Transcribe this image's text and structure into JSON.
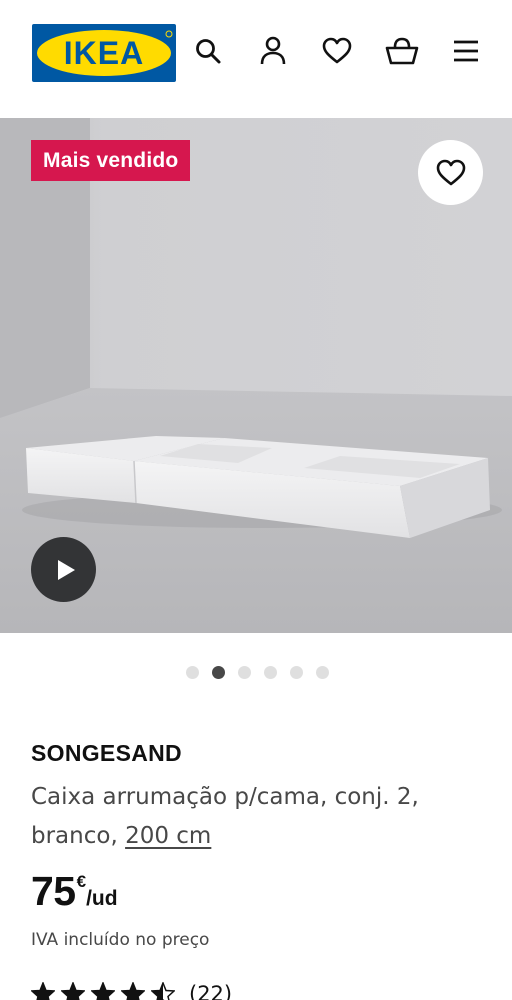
{
  "header": {
    "logo_text": "IKEA",
    "icons": [
      "search-icon",
      "user-icon",
      "heart-icon",
      "basket-icon",
      "menu-icon"
    ]
  },
  "hero": {
    "badge": "Mais vendido",
    "favourite_icon": "heart-icon",
    "play_icon": "play-icon",
    "image_count": 6,
    "active_image": 2
  },
  "product": {
    "name": "SONGESAND",
    "description": "Caixa arrumação p/cama, conj. 2, branco, ",
    "size_link": "200 cm",
    "price_value": "75",
    "currency": "€",
    "unit": "/ud",
    "vat_note": "IVA incluído no preço",
    "rating_value": 4.5,
    "rating_max": 5,
    "review_count": "(22)"
  },
  "colors": {
    "brand_blue": "#0058a3",
    "brand_yellow": "#ffdb00",
    "badge_red": "#d6174e",
    "text": "#111111",
    "muted_text": "#484848"
  }
}
